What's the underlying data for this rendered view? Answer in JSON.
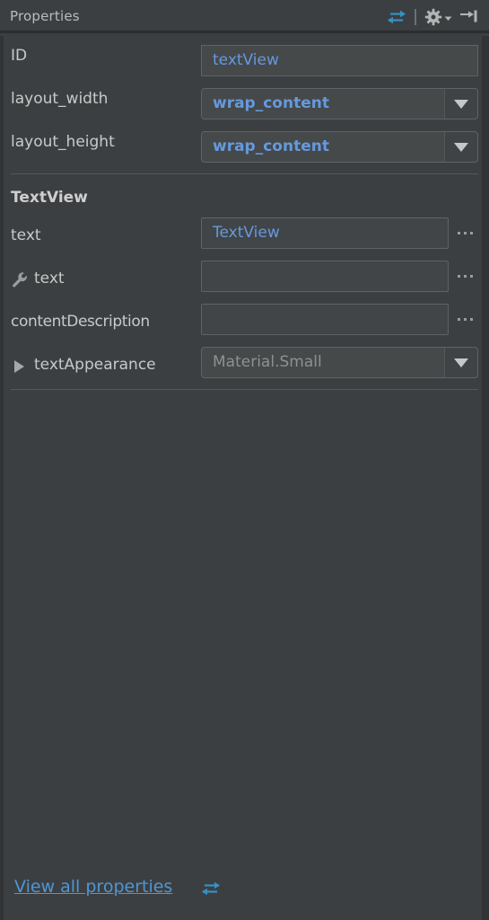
{
  "header": {
    "title": "Properties",
    "icons": [
      {
        "name": "toggle-view-arrows-icon",
        "glyph": "bidirectional-arrows"
      },
      {
        "name": "settings-gear-icon",
        "glyph": "gear-dropdown"
      },
      {
        "name": "hide-panel-icon",
        "glyph": "arrow-to-bar"
      }
    ]
  },
  "rows": [
    {
      "key": "id",
      "label": "ID",
      "value": "textView",
      "kind": "text",
      "has_ellipsis": false
    },
    {
      "key": "layout_width",
      "label": "layout_width",
      "value": "wrap_content",
      "kind": "combo",
      "has_ellipsis": false
    },
    {
      "key": "layout_height",
      "label": "layout_height",
      "value": "wrap_content",
      "kind": "combo",
      "has_ellipsis": false
    }
  ],
  "section": {
    "title": "TextView",
    "rows": [
      {
        "key": "text",
        "label": "text",
        "value": "TextView",
        "kind": "text",
        "has_ellipsis": true,
        "icon": null
      },
      {
        "key": "tools_text",
        "label": "text",
        "value": "",
        "kind": "text",
        "has_ellipsis": true,
        "icon": "wrench-icon"
      },
      {
        "key": "contentDescription",
        "label": "contentDescription",
        "value": "",
        "kind": "text",
        "has_ellipsis": true,
        "icon": null
      },
      {
        "key": "textAppearance",
        "label": "textAppearance",
        "value": "Material.Small",
        "kind": "combo",
        "has_ellipsis": false,
        "icon": "expand-triangle-icon"
      }
    ]
  },
  "footer": {
    "link_label": "View all properties",
    "link_icon": "bidirectional-arrows-icon"
  },
  "colors": {
    "panel_bg": "#3c3f41",
    "field_bg": "#45494a",
    "field_border": "#5f6365",
    "value_blue": "#6699dd",
    "link_blue": "#4e96d6",
    "label_gray": "#c9c9c9",
    "muted_gray": "#8e9194",
    "separator": "#54585a",
    "edge_dark": "#313335"
  }
}
